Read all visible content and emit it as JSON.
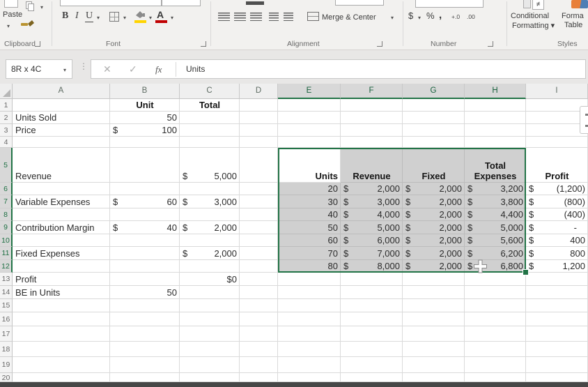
{
  "colors": {
    "accent_green": "#217346",
    "selection_fill": "#d0d0d0"
  },
  "ribbon": {
    "caret": "▾",
    "paste": "Paste",
    "bold": "B",
    "italic": "I",
    "underline": "U",
    "font_color_letter": "A",
    "merge_center": "Merge & Center",
    "currency": "$",
    "percent": "%",
    "comma": ",",
    "increase_decimal": "+.0",
    "decrease_decimal": ".00",
    "not_equal": "≠",
    "conditional_line1": "Conditional",
    "conditional_line2": "Formatting ▾",
    "format_table_line1": "Forma",
    "format_table_line2": "Table",
    "groups": {
      "clipboard": "Clipboard",
      "font": "Font",
      "alignment": "Alignment",
      "number": "Number",
      "styles": "Styles"
    }
  },
  "formula_bar": {
    "name_box": "8R x 4C",
    "dots": "⋮",
    "cancel": "✕",
    "enter": "✓",
    "fx": "fx",
    "value": "Units"
  },
  "sheet": {
    "columns": [
      "A",
      "B",
      "C",
      "D",
      "E",
      "F",
      "G",
      "H",
      "I"
    ],
    "selected_columns": [
      "E",
      "F",
      "G",
      "H"
    ],
    "rows": [
      "1",
      "2",
      "3",
      "4",
      "5",
      "6",
      "7",
      "8",
      "9",
      "10",
      "11",
      "12",
      "13",
      "14",
      "15",
      "16",
      "17",
      "18",
      "19",
      "20"
    ],
    "selected_rows": [
      "5",
      "6",
      "7",
      "8",
      "9",
      "10",
      "11",
      "12"
    ],
    "selection": {
      "range": "E5:H12",
      "active_cell": "E5"
    },
    "cells": [
      {
        "r": 1,
        "c": "B",
        "v": "Unit",
        "b": 1,
        "al": "c"
      },
      {
        "r": 1,
        "c": "C",
        "v": "Total",
        "b": 1,
        "al": "c"
      },
      {
        "r": 2,
        "c": "A",
        "v": "Units Sold"
      },
      {
        "r": 2,
        "c": "B",
        "v": "50",
        "al": "r"
      },
      {
        "r": 3,
        "c": "A",
        "v": "Price"
      },
      {
        "r": 3,
        "c": "B",
        "s": "$",
        "v": "100"
      },
      {
        "r": 5,
        "c": "A",
        "v": "Revenue"
      },
      {
        "r": 5,
        "c": "C",
        "s": "$",
        "v": "5,000"
      },
      {
        "r": 5,
        "c": "E",
        "v": "Units",
        "b": 1,
        "al": "r"
      },
      {
        "r": 5,
        "c": "F",
        "v": "Revenue",
        "b": 1,
        "al": "c"
      },
      {
        "r": 5,
        "c": "G",
        "v": "Fixed",
        "b": 1,
        "al": "c"
      },
      {
        "r": 5,
        "c": "H",
        "v": "Total Expenses",
        "b": 1,
        "al": "c",
        "wrap": 1
      },
      {
        "r": 5,
        "c": "I",
        "v": "Profit",
        "b": 1,
        "al": "c"
      },
      {
        "r": 6,
        "c": "E",
        "v": "20",
        "al": "r"
      },
      {
        "r": 6,
        "c": "F",
        "s": "$",
        "v": "2,000"
      },
      {
        "r": 6,
        "c": "G",
        "s": "$",
        "v": "2,000"
      },
      {
        "r": 6,
        "c": "H",
        "s": "$",
        "v": "3,200"
      },
      {
        "r": 6,
        "c": "I",
        "s": "$",
        "v": "(1,200)"
      },
      {
        "r": 7,
        "c": "A",
        "v": "Variable Expenses"
      },
      {
        "r": 7,
        "c": "B",
        "s": "$",
        "v": "60"
      },
      {
        "r": 7,
        "c": "C",
        "s": "$",
        "v": "3,000"
      },
      {
        "r": 7,
        "c": "E",
        "v": "30",
        "al": "r"
      },
      {
        "r": 7,
        "c": "F",
        "s": "$",
        "v": "3,000"
      },
      {
        "r": 7,
        "c": "G",
        "s": "$",
        "v": "2,000"
      },
      {
        "r": 7,
        "c": "H",
        "s": "$",
        "v": "3,800"
      },
      {
        "r": 7,
        "c": "I",
        "s": "$",
        "v": "(800)"
      },
      {
        "r": 8,
        "c": "E",
        "v": "40",
        "al": "r"
      },
      {
        "r": 8,
        "c": "F",
        "s": "$",
        "v": "4,000"
      },
      {
        "r": 8,
        "c": "G",
        "s": "$",
        "v": "2,000"
      },
      {
        "r": 8,
        "c": "H",
        "s": "$",
        "v": "4,400"
      },
      {
        "r": 8,
        "c": "I",
        "s": "$",
        "v": "(400)"
      },
      {
        "r": 9,
        "c": "A",
        "v": "Contribution Margin"
      },
      {
        "r": 9,
        "c": "B",
        "s": "$",
        "v": "40"
      },
      {
        "r": 9,
        "c": "C",
        "s": "$",
        "v": "2,000"
      },
      {
        "r": 9,
        "c": "E",
        "v": "50",
        "al": "r"
      },
      {
        "r": 9,
        "c": "F",
        "s": "$",
        "v": "5,000"
      },
      {
        "r": 9,
        "c": "G",
        "s": "$",
        "v": "2,000"
      },
      {
        "r": 9,
        "c": "H",
        "s": "$",
        "v": "5,000"
      },
      {
        "r": 9,
        "c": "I",
        "s": "$",
        "v": "-",
        "pad": 1
      },
      {
        "r": 10,
        "c": "E",
        "v": "60",
        "al": "r"
      },
      {
        "r": 10,
        "c": "F",
        "s": "$",
        "v": "6,000"
      },
      {
        "r": 10,
        "c": "G",
        "s": "$",
        "v": "2,000"
      },
      {
        "r": 10,
        "c": "H",
        "s": "$",
        "v": "5,600"
      },
      {
        "r": 10,
        "c": "I",
        "s": "$",
        "v": "400"
      },
      {
        "r": 11,
        "c": "A",
        "v": "Fixed Expenses"
      },
      {
        "r": 11,
        "c": "C",
        "s": "$",
        "v": "2,000"
      },
      {
        "r": 11,
        "c": "E",
        "v": "70",
        "al": "r"
      },
      {
        "r": 11,
        "c": "F",
        "s": "$",
        "v": "7,000"
      },
      {
        "r": 11,
        "c": "G",
        "s": "$",
        "v": "2,000"
      },
      {
        "r": 11,
        "c": "H",
        "s": "$",
        "v": "6,200"
      },
      {
        "r": 11,
        "c": "I",
        "s": "$",
        "v": "800"
      },
      {
        "r": 12,
        "c": "E",
        "v": "80",
        "al": "r"
      },
      {
        "r": 12,
        "c": "F",
        "s": "$",
        "v": "8,000"
      },
      {
        "r": 12,
        "c": "G",
        "s": "$",
        "v": "2,000"
      },
      {
        "r": 12,
        "c": "H",
        "s": "$",
        "v": "6,800"
      },
      {
        "r": 12,
        "c": "I",
        "s": "$",
        "v": "1,200"
      },
      {
        "r": 13,
        "c": "A",
        "v": "Profit"
      },
      {
        "r": 13,
        "c": "C",
        "v": "$0",
        "al": "r"
      },
      {
        "r": 14,
        "c": "A",
        "v": "BE in Units"
      },
      {
        "r": 14,
        "c": "B",
        "v": "50",
        "al": "r"
      }
    ]
  }
}
